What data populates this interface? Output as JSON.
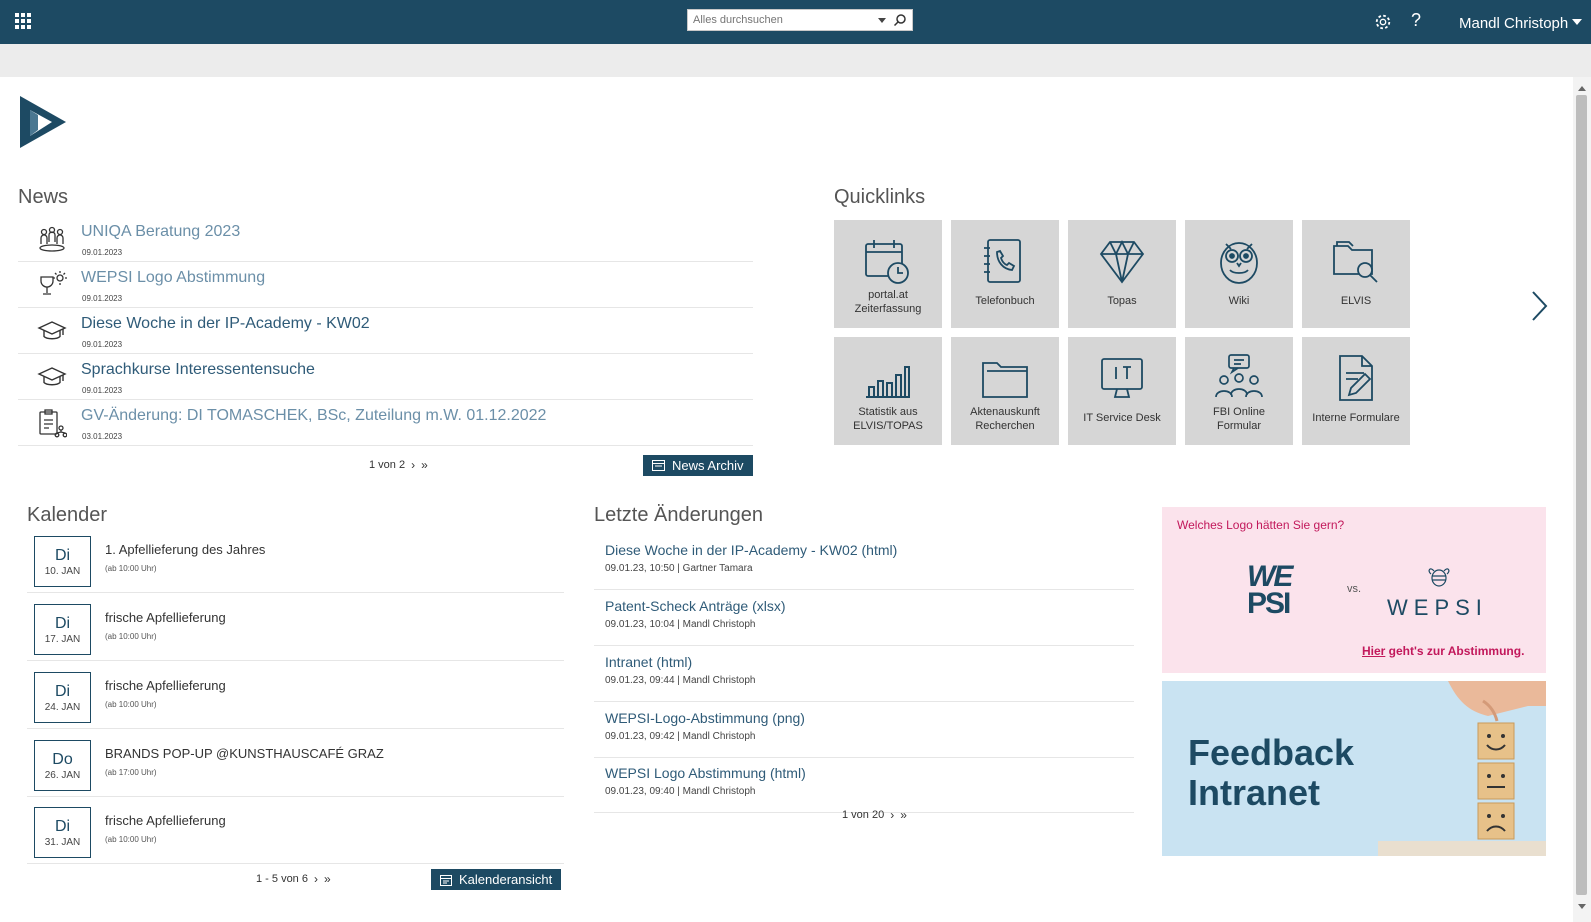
{
  "topbar": {
    "search_placeholder": "Alles durchsuchen",
    "help_label": "?",
    "user_name": "Mandl Christoph"
  },
  "news": {
    "heading": "News",
    "items": [
      {
        "title": "UNIQA Beratung 2023",
        "date": "09.01.2023",
        "icon": "people-group-icon"
      },
      {
        "title": "WEPSI Logo Abstimmung",
        "date": "09.01.2023",
        "icon": "idea-trophy-icon"
      },
      {
        "title": "Diese Woche in der IP-Academy - KW02",
        "date": "09.01.2023",
        "icon": "graduation-cap-icon"
      },
      {
        "title": "Sprachkurse Interessentensuche",
        "date": "09.01.2023",
        "icon": "graduation-cap-icon"
      },
      {
        "title": "GV-Änderung: DI TOMASCHEK, BSc, Zuteilung m.W. 01.12.2022",
        "date": "03.01.2023",
        "icon": "clipboard-org-icon"
      }
    ],
    "pager": "1 von 2",
    "archive_button": "News Archiv"
  },
  "quicklinks": {
    "heading": "Quicklinks",
    "tiles": [
      {
        "label_line1": "portal.at",
        "label_line2": "Zeiterfassung",
        "icon": "calendar-clock-icon"
      },
      {
        "label_line1": "Telefonbuch",
        "label_line2": "",
        "icon": "phone-book-icon"
      },
      {
        "label_line1": "Topas",
        "label_line2": "",
        "icon": "diamond-icon"
      },
      {
        "label_line1": "Wiki",
        "label_line2": "",
        "icon": "owl-icon"
      },
      {
        "label_line1": "ELVIS",
        "label_line2": "",
        "icon": "folder-search-icon"
      },
      {
        "label_line1": "Statistik aus",
        "label_line2": "ELVIS/TOPAS",
        "icon": "bar-chart-icon"
      },
      {
        "label_line1": "Aktenauskunft",
        "label_line2": "Recherchen",
        "icon": "folder-icon"
      },
      {
        "label_line1": "IT Service Desk",
        "label_line2": "",
        "icon": "monitor-it-icon"
      },
      {
        "label_line1": "FBI Online",
        "label_line2": "Formular",
        "icon": "people-chat-icon"
      },
      {
        "label_line1": "Interne Formulare",
        "label_line2": "",
        "icon": "document-edit-icon"
      }
    ]
  },
  "kalender": {
    "heading": "Kalender",
    "items": [
      {
        "weekday": "Di",
        "date": "10. JAN",
        "event": "1. Apfellieferung des Jahres",
        "time": "(ab 10:00 Uhr)"
      },
      {
        "weekday": "Di",
        "date": "17. JAN",
        "event": "frische Apfellieferung",
        "time": "(ab 10:00 Uhr)"
      },
      {
        "weekday": "Di",
        "date": "24. JAN",
        "event": "frische Apfellieferung",
        "time": "(ab 10:00 Uhr)"
      },
      {
        "weekday": "Do",
        "date": "26. JAN",
        "event": "BRANDS POP-UP @KUNSTHAUSCAFÉ GRAZ",
        "time": "(ab 17:00 Uhr)"
      },
      {
        "weekday": "Di",
        "date": "31. JAN",
        "event": "frische Apfellieferung",
        "time": "(ab 10:00 Uhr)"
      }
    ],
    "pager": "1 - 5 von 6",
    "view_button": "Kalenderansicht"
  },
  "changes": {
    "heading": "Letzte Änderungen",
    "items": [
      {
        "title": "Diese Woche in der IP-Academy - KW02 (html)",
        "meta": "09.01.23, 10:50 | Gartner Tamara"
      },
      {
        "title": "Patent-Scheck Anträge (xlsx)",
        "meta": "09.01.23, 10:04 | Mandl Christoph"
      },
      {
        "title": "Intranet (html)",
        "meta": "09.01.23, 09:44 | Mandl Christoph"
      },
      {
        "title": "WEPSI-Logo-Abstimmung (png)",
        "meta": "09.01.23, 09:42 | Mandl Christoph"
      },
      {
        "title": "WEPSI Logo Abstimmung (html)",
        "meta": "09.01.23, 09:40 | Mandl Christoph"
      }
    ],
    "pager": "1 von 20"
  },
  "wepsi_banner": {
    "question": "Welches Logo hätten Sie gern?",
    "logo_left_top": "WE",
    "logo_left_bottom": "PSI",
    "vs": "vs.",
    "logo_right": "WEPSI",
    "cta_link": "Hier",
    "cta_rest": " geht's zur Abstimmung."
  },
  "feedback_banner": {
    "line1": "Feedback",
    "line2": "Intranet"
  },
  "colors": {
    "brand": "#1d4a63",
    "link": "#2f5b78",
    "tile_bg": "#d6d6d6",
    "accent_pink": "#c2185b"
  }
}
